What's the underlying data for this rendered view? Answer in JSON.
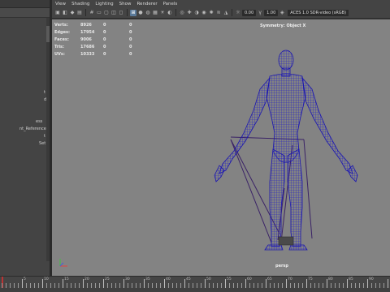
{
  "menu": {
    "items": [
      "View",
      "Shading",
      "Lighting",
      "Show",
      "Renderer",
      "Panels"
    ]
  },
  "toolbar": {
    "field_a": "0.00",
    "field_b": "1.00",
    "colorspace": "ACES 1.0 SDR-video (sRGB)"
  },
  "outliner": {
    "items": [
      "t",
      "d",
      "",
      "",
      "ess",
      "nt_Reference",
      "t",
      "Set"
    ]
  },
  "hud": {
    "rows": [
      {
        "label": "Verts:",
        "v1": "8926",
        "v2": "0",
        "v3": "0"
      },
      {
        "label": "Edges:",
        "v1": "17954",
        "v2": "0",
        "v3": "0"
      },
      {
        "label": "Faces:",
        "v1": "9006",
        "v2": "0",
        "v3": "0"
      },
      {
        "label": "Tris:",
        "v1": "17686",
        "v2": "0",
        "v3": "0"
      },
      {
        "label": "UVs:",
        "v1": "10333",
        "v2": "0",
        "v3": "0"
      }
    ],
    "symmetry": "Symmetry: Object X",
    "camera": "persp"
  },
  "timeline": {
    "labels": [
      "5",
      "10",
      "15",
      "20",
      "25",
      "30",
      "35",
      "40",
      "45",
      "50",
      "55",
      "60",
      "65",
      "70",
      "75",
      "80",
      "85",
      "90"
    ]
  },
  "colors": {
    "viewport_bg": "#838383",
    "wire": "#1f1bc8",
    "accent": "#5a7a9a"
  }
}
